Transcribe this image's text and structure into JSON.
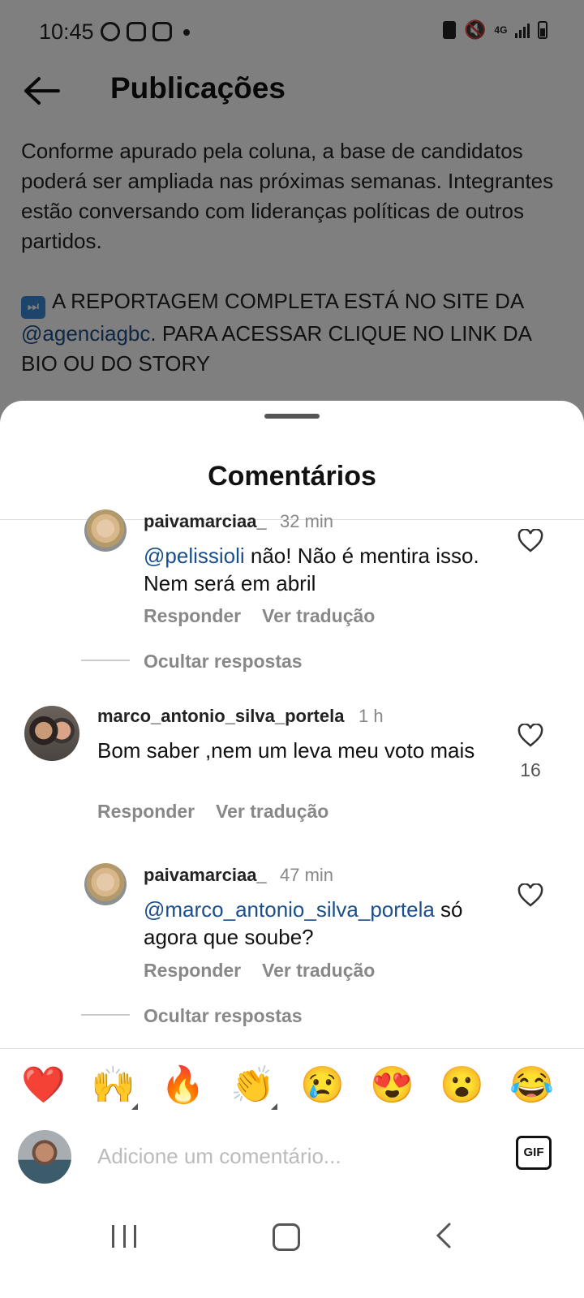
{
  "status_bar": {
    "time": "10:45",
    "network": "4G"
  },
  "header": {
    "title": "Publicações",
    "back_icon": "arrow-left-icon"
  },
  "post": {
    "caption_p1": "Conforme apurado pela coluna, a base de candidatos poderá ser ampliada nas próximas semanas. Integrantes estão conversando com lideranças políticas de outros partidos.",
    "caption_p2_before": "A REPORTAGEM COMPLETA ESTÁ NO SITE DA ",
    "caption_p2_mention": "@agenciagbc",
    "caption_p2_after": ". PARA ACESSAR CLIQUE NO LINK DA BIO OU DO STORY"
  },
  "sheet": {
    "title": "Comentários"
  },
  "comments": [
    {
      "username": "paivamarciaa_",
      "time": "32 min",
      "mention": "@pelissioli",
      "text": " não! Não é mentira isso. Nem será em abril",
      "reply": "Responder",
      "translate": "Ver tradução",
      "hide_replies": "Ocultar respostas"
    },
    {
      "username": "marco_antonio_silva_portela",
      "time": "1 h",
      "text": "Bom saber ,nem um leva meu voto mais",
      "reply": "Responder",
      "translate": "Ver tradução",
      "likes": "16"
    },
    {
      "username": "paivamarciaa_",
      "time": "47 min",
      "mention": "@marco_antonio_silva_portela",
      "text": " só agora que soube?",
      "reply": "Responder",
      "translate": "Ver tradução",
      "hide_replies": "Ocultar respostas"
    }
  ],
  "emoji_bar": [
    "❤️",
    "🙌",
    "🔥",
    "👏",
    "😢",
    "😍",
    "😮",
    "😂"
  ],
  "composer": {
    "placeholder": "Adicione um comentário...",
    "gif_label": "GIF"
  },
  "colors": {
    "mention": "#1a4f8a",
    "overlay": "rgba(0,0,0,0.5)",
    "muted_text": "#888888"
  }
}
